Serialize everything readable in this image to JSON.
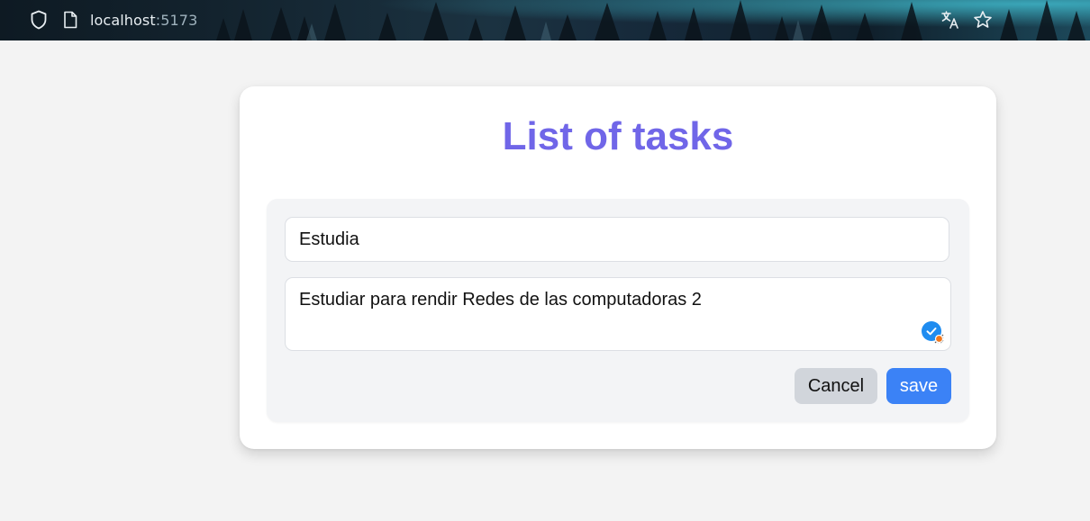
{
  "browser": {
    "url_host": "localhost",
    "url_port": ":5173",
    "icons": {
      "security": "shield-icon",
      "page": "page-icon",
      "translate": "translate-icon",
      "bookmark": "star-icon"
    }
  },
  "page": {
    "title": "List of tasks",
    "form": {
      "title_value": "Estudia",
      "description_value": "Estudiar para rendir Redes de las computadoras 2",
      "cancel_label": "Cancel",
      "save_label": "save"
    }
  },
  "colors": {
    "title": "#7066e8",
    "save_button": "#3b82f6",
    "cancel_button": "#d1d5db",
    "panel": "#f3f4f6",
    "background": "#f3f3f3"
  }
}
